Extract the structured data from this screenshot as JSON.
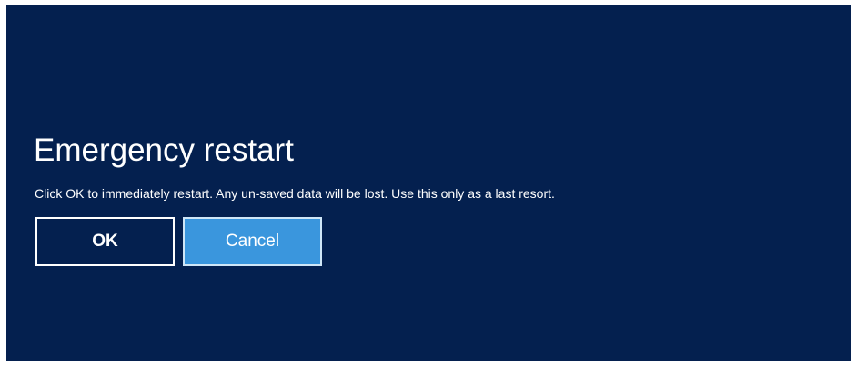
{
  "dialog": {
    "title": "Emergency restart",
    "message": "Click OK to immediately restart.  Any un-saved data will be lost.  Use this only as a last resort.",
    "buttons": {
      "ok_label": "OK",
      "cancel_label": "Cancel"
    }
  },
  "colors": {
    "background": "#04204f",
    "text": "#ffffff",
    "cancel_button": "#3a96dd"
  }
}
